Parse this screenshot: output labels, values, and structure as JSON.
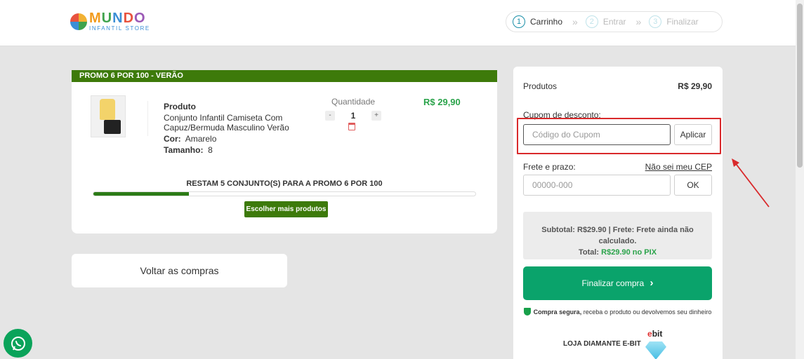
{
  "header": {
    "logo_main": [
      "M",
      "U",
      "N",
      "D",
      "O"
    ],
    "logo_sub": "INFANTIL STORE",
    "steps": [
      {
        "num": "1",
        "label": "Carrinho"
      },
      {
        "num": "2",
        "label": "Entrar"
      },
      {
        "num": "3",
        "label": "Finalizar"
      }
    ],
    "step_separator": "»"
  },
  "cart": {
    "promo_title": "PROMO 6 POR 100 - VERÃO",
    "product_head": "Produto",
    "product_name_1": "Conjunto Infantil Camiseta Com",
    "product_name_2": "Capuz/Bermuda Masculino Verão",
    "color_label": "Cor:",
    "color_value": "Amarelo",
    "size_label": "Tamanho:",
    "size_value": "8",
    "quantity_label": "Quantidade",
    "quantity_minus": "-",
    "quantity_value": "1",
    "quantity_plus": "+",
    "price": "R$ 29,90",
    "remaining_text": "RESTAM 5 CONJUNTO(S) PARA A PROMO 6 POR 100",
    "progress_fraction": 0.25,
    "more_products_button": "Escolher mais produtos",
    "back_button": "Voltar as compras"
  },
  "summary": {
    "products_label": "Produtos",
    "products_value": "R$ 29,90",
    "coupon_label": "Cupom de desconto:",
    "coupon_placeholder": "Código do Cupom",
    "coupon_apply": "Aplicar",
    "shipping_label": "Frete e prazo:",
    "shipping_link": "Não sei meu CEP",
    "cep_placeholder": "00000-000",
    "cep_ok": "OK",
    "subtotal_line": "Subtotal: R$29.90 | Frete: Frete ainda não calculado.",
    "total_label": "Total:",
    "total_value": "R$29.90 no PIX",
    "checkout_button": "Finalizar compra",
    "checkout_chevron": "›",
    "secure_bold": "Compra segura,",
    "secure_rest": " receba o produto ou devolvemos seu dinheiro",
    "diamond_label": "LOJA DIAMANTE E-BIT",
    "ebit_prefix": "e",
    "ebit_text": "bit"
  },
  "colors": {
    "accent_green": "#0aa36b",
    "promo_green": "#3d7a0a",
    "price_green": "#2aa34a",
    "highlight_red": "#d9292b"
  },
  "icons": [
    "whatsapp-icon",
    "trash-icon",
    "shield-icon",
    "chevron-right-icon",
    "diamond-icon"
  ]
}
